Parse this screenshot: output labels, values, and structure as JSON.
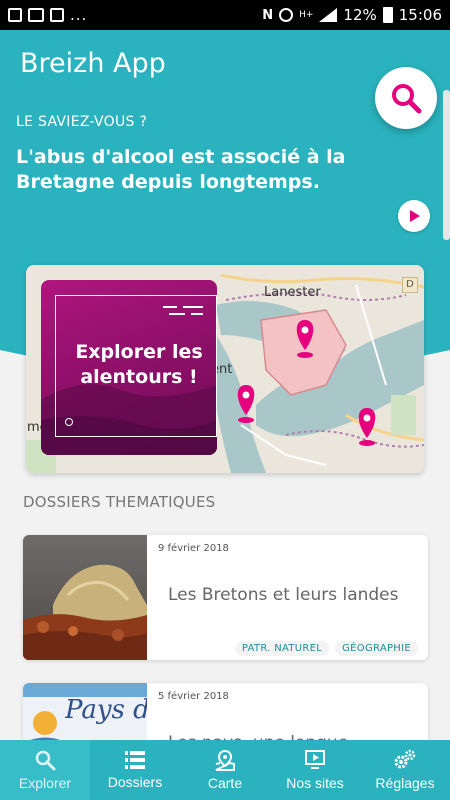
{
  "status_bar": {
    "time": "15:06",
    "battery": "12%",
    "dots": "..."
  },
  "header": {
    "app_title": "Breizh App",
    "search_icon": "search-icon"
  },
  "did_you_know": {
    "label": "LE SAVIEZ-VOUS ?",
    "fact": "L'abus d'alcool est associé à la Bretagne depuis longtemps.",
    "play_icon": "play-icon"
  },
  "explore_card": {
    "title": "Explorer les alentours !",
    "map_labels": {
      "lanester": "Lanester",
      "lorient": "rient",
      "left_edge": "me",
      "badge": "D"
    }
  },
  "section": {
    "title": "DOSSIERS THEMATIQUES"
  },
  "articles": [
    {
      "date": "9 février 2018",
      "title": "Les Bretons et leurs landes",
      "tags": [
        "PATR. NATUREL",
        "GÉOGRAPHIE"
      ]
    },
    {
      "date": "5 février 2018",
      "title": "Les pays, une longue",
      "image_text": "Pays d"
    }
  ],
  "nav": {
    "items": [
      {
        "label": "Explorer",
        "icon": "explore-icon",
        "active": true
      },
      {
        "label": "Dossiers",
        "icon": "list-icon",
        "active": false
      },
      {
        "label": "Carte",
        "icon": "map-icon",
        "active": false
      },
      {
        "label": "Nos sites",
        "icon": "screen-icon",
        "active": false
      },
      {
        "label": "Réglages",
        "icon": "gears-icon",
        "active": false
      }
    ]
  },
  "colors": {
    "primary": "#2ab3be",
    "accent": "#e6007e",
    "explore_box": "#a0127a"
  }
}
